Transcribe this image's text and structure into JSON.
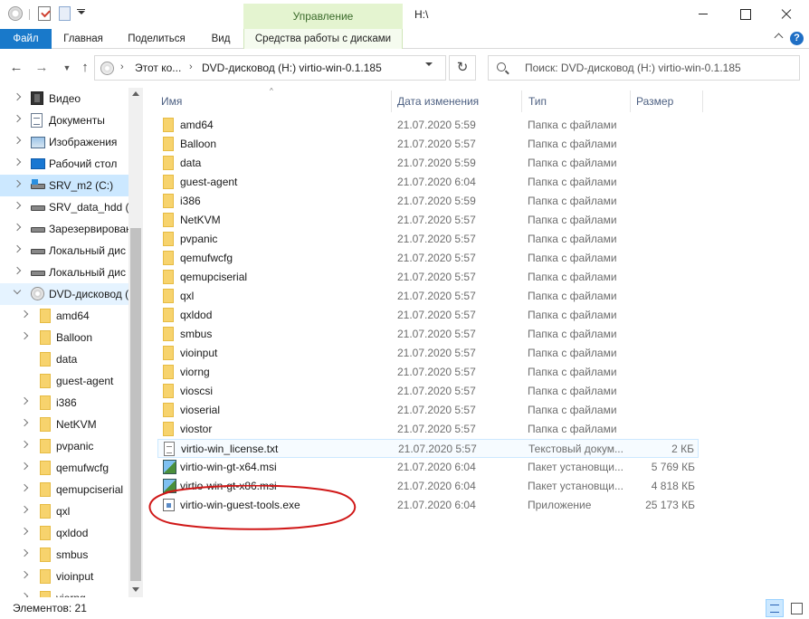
{
  "titlebar": {
    "context_header": "Управление",
    "path_title": "H:\\"
  },
  "ribbon": {
    "tabs": [
      "Файл",
      "Главная",
      "Поделиться",
      "Вид",
      "Средства работы с дисками"
    ],
    "help": "?"
  },
  "address": {
    "segments": [
      "Этот ко...",
      "DVD-дисковод (H:) virtio-win-0.1.185"
    ],
    "search_placeholder": "Поиск: DVD-дисковод (H:) virtio-win-0.1.185"
  },
  "nav": {
    "items": [
      {
        "label": "Видео",
        "icon": "video-icon"
      },
      {
        "label": "Документы",
        "icon": "documents-icon"
      },
      {
        "label": "Изображения",
        "icon": "pictures-icon"
      },
      {
        "label": "Рабочий стол",
        "icon": "desktop-icon"
      },
      {
        "label": "SRV_m2 (C:)",
        "icon": "system-drive-icon"
      },
      {
        "label": "SRV_data_hdd (D",
        "icon": "drive-icon"
      },
      {
        "label": "Зарезервирован",
        "icon": "drive-icon"
      },
      {
        "label": "Локальный дис",
        "icon": "drive-icon"
      },
      {
        "label": "Локальный дис",
        "icon": "drive-icon"
      },
      {
        "label": "DVD-дисковод (",
        "icon": "dvd-icon"
      },
      {
        "label": "amd64",
        "icon": "folder-icon"
      },
      {
        "label": "Balloon",
        "icon": "folder-icon"
      },
      {
        "label": "data",
        "icon": "folder-icon"
      },
      {
        "label": "guest-agent",
        "icon": "folder-icon"
      },
      {
        "label": "i386",
        "icon": "folder-icon"
      },
      {
        "label": "NetKVM",
        "icon": "folder-icon"
      },
      {
        "label": "pvpanic",
        "icon": "folder-icon"
      },
      {
        "label": "qemufwcfg",
        "icon": "folder-icon"
      },
      {
        "label": "qemupciserial",
        "icon": "folder-icon"
      },
      {
        "label": "qxl",
        "icon": "folder-icon"
      },
      {
        "label": "qxldod",
        "icon": "folder-icon"
      },
      {
        "label": "smbus",
        "icon": "folder-icon"
      },
      {
        "label": "vioinput",
        "icon": "folder-icon"
      },
      {
        "label": "viorng",
        "icon": "folder-icon"
      }
    ]
  },
  "columns": {
    "name": "Имя",
    "date": "Дата изменения",
    "type": "Тип",
    "size": "Размер"
  },
  "files": [
    {
      "name": "amd64",
      "date": "21.07.2020 5:59",
      "type": "Папка с файлами",
      "size": "",
      "icon": "folder-icon"
    },
    {
      "name": "Balloon",
      "date": "21.07.2020 5:57",
      "type": "Папка с файлами",
      "size": "",
      "icon": "folder-icon"
    },
    {
      "name": "data",
      "date": "21.07.2020 5:59",
      "type": "Папка с файлами",
      "size": "",
      "icon": "folder-icon"
    },
    {
      "name": "guest-agent",
      "date": "21.07.2020 6:04",
      "type": "Папка с файлами",
      "size": "",
      "icon": "folder-icon"
    },
    {
      "name": "i386",
      "date": "21.07.2020 5:59",
      "type": "Папка с файлами",
      "size": "",
      "icon": "folder-icon"
    },
    {
      "name": "NetKVM",
      "date": "21.07.2020 5:57",
      "type": "Папка с файлами",
      "size": "",
      "icon": "folder-icon"
    },
    {
      "name": "pvpanic",
      "date": "21.07.2020 5:57",
      "type": "Папка с файлами",
      "size": "",
      "icon": "folder-icon"
    },
    {
      "name": "qemufwcfg",
      "date": "21.07.2020 5:57",
      "type": "Папка с файлами",
      "size": "",
      "icon": "folder-icon"
    },
    {
      "name": "qemupciserial",
      "date": "21.07.2020 5:57",
      "type": "Папка с файлами",
      "size": "",
      "icon": "folder-icon"
    },
    {
      "name": "qxl",
      "date": "21.07.2020 5:57",
      "type": "Папка с файлами",
      "size": "",
      "icon": "folder-icon"
    },
    {
      "name": "qxldod",
      "date": "21.07.2020 5:57",
      "type": "Папка с файлами",
      "size": "",
      "icon": "folder-icon"
    },
    {
      "name": "smbus",
      "date": "21.07.2020 5:57",
      "type": "Папка с файлами",
      "size": "",
      "icon": "folder-icon"
    },
    {
      "name": "vioinput",
      "date": "21.07.2020 5:57",
      "type": "Папка с файлами",
      "size": "",
      "icon": "folder-icon"
    },
    {
      "name": "viorng",
      "date": "21.07.2020 5:57",
      "type": "Папка с файлами",
      "size": "",
      "icon": "folder-icon"
    },
    {
      "name": "vioscsi",
      "date": "21.07.2020 5:57",
      "type": "Папка с файлами",
      "size": "",
      "icon": "folder-icon"
    },
    {
      "name": "vioserial",
      "date": "21.07.2020 5:57",
      "type": "Папка с файлами",
      "size": "",
      "icon": "folder-icon"
    },
    {
      "name": "viostor",
      "date": "21.07.2020 5:57",
      "type": "Папка с файлами",
      "size": "",
      "icon": "folder-icon"
    },
    {
      "name": "virtio-win_license.txt",
      "date": "21.07.2020 5:57",
      "type": "Текстовый докум...",
      "size": "2 КБ",
      "icon": "text-file-icon"
    },
    {
      "name": "virtio-win-gt-x64.msi",
      "date": "21.07.2020 6:04",
      "type": "Пакет установщи...",
      "size": "5 769 КБ",
      "icon": "msi-installer-icon"
    },
    {
      "name": "virtio-win-gt-x86.msi",
      "date": "21.07.2020 6:04",
      "type": "Пакет установщи...",
      "size": "4 818 КБ",
      "icon": "msi-installer-icon"
    },
    {
      "name": "virtio-win-guest-tools.exe",
      "date": "21.07.2020 6:04",
      "type": "Приложение",
      "size": "25 173 КБ",
      "icon": "exe-application-icon"
    }
  ],
  "status": {
    "count_text": "Элементов: 21"
  },
  "colors": {
    "file_tab": "#1979ca",
    "context_header": "#e4f4d0",
    "selection": "#cce8ff",
    "annotation": "#d01818"
  }
}
